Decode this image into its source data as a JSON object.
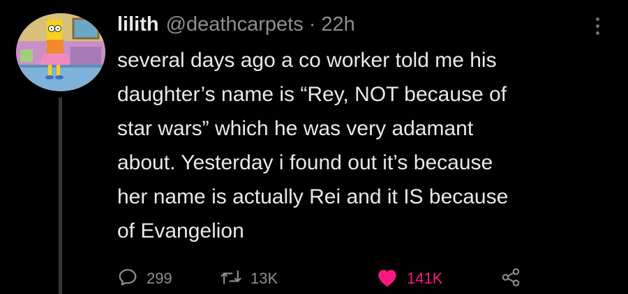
{
  "tweet": {
    "display_name": "lilith",
    "handle": "@deathcarpets",
    "separator": "·",
    "timestamp": "22h",
    "text": "several days ago a co worker told me his\ndaughter’s name is “Rey, NOT because of\nstar wars” which he was very adamant\nabout. Yesterday i found out it’s because\nher name is actually Rei and it IS because\nof Evangelion",
    "actions": {
      "reply_count": "299",
      "retweet_count": "13K",
      "like_count": "141K"
    },
    "icons": {
      "reply": "speech-bubble-icon",
      "retweet": "retweet-arrows-icon",
      "like": "heart-icon",
      "share": "share-nodes-icon",
      "more": "more-vertical-icon"
    },
    "colors": {
      "background": "#000000",
      "text": "#e7e9ea",
      "secondary": "#8b8f93",
      "like": "#f91880"
    }
  }
}
